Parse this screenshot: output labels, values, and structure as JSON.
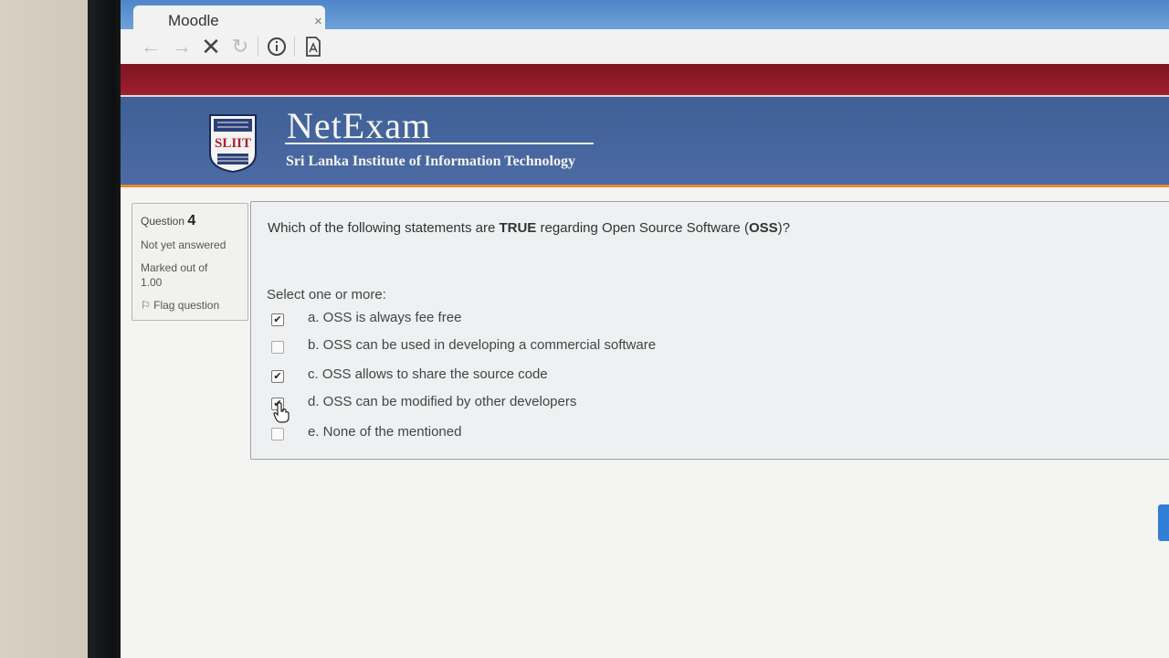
{
  "browser": {
    "tab_title": "Moodle",
    "tab_close": "×",
    "nav_icons": [
      "back-arrow-icon",
      "forward-arrow-icon",
      "stop-icon",
      "reload-icon",
      "info-icon",
      "reader-mode-icon"
    ]
  },
  "header": {
    "brand": "NetExam",
    "subtitle": "Sri Lanka Institute of Information Technology",
    "logo_text": "SLIIT"
  },
  "question_info": {
    "question_label": "Question",
    "question_number": "4",
    "state": "Not yet answered",
    "marked": "Marked out of 1.00",
    "flag_label": "Flag question"
  },
  "question": {
    "text_parts": [
      "Which of the following statements are ",
      "TRUE",
      " regarding Open Source Software (",
      "OSS",
      ")?"
    ],
    "prompt": "Select one or more:",
    "options": [
      {
        "label": "a. OSS is always fee free",
        "checked": true
      },
      {
        "label": "b. OSS can be used in developing a commercial software",
        "checked": false
      },
      {
        "label": "c. OSS allows to share the source code",
        "checked": true
      },
      {
        "label": "d. OSS can be modified by other developers",
        "checked": true
      },
      {
        "label": "e. None of the mentioned",
        "checked": false
      }
    ]
  },
  "colors": {
    "red_band": "#a01f2e",
    "blue_band": "#4c6ba4",
    "accent_orange": "#e58a2c",
    "tab_strip": "#5b90cf"
  }
}
